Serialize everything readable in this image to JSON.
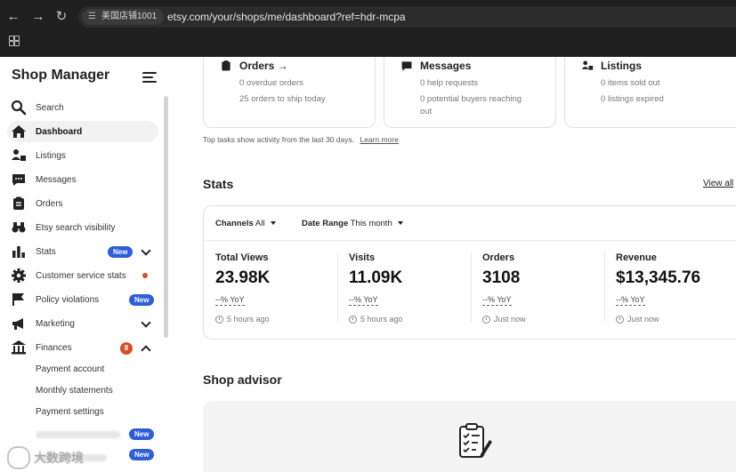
{
  "browser": {
    "url": "etsy.com/your/shops/me/dashboard?ref=hdr-mcpa",
    "site_label": "美国店铺1001"
  },
  "sidebar": {
    "title": "Shop Manager",
    "items": [
      {
        "label": "Search",
        "icon": "search-icon"
      },
      {
        "label": "Dashboard",
        "icon": "home-icon"
      },
      {
        "label": "Listings",
        "icon": "listings-icon"
      },
      {
        "label": "Messages",
        "icon": "messages-icon"
      },
      {
        "label": "Orders",
        "icon": "orders-icon"
      },
      {
        "label": "Etsy search visibility",
        "icon": "binoculars-icon"
      },
      {
        "label": "Stats",
        "icon": "stats-icon",
        "badge": "New"
      },
      {
        "label": "Customer service stats",
        "icon": "gear-icon"
      },
      {
        "label": "Policy violations",
        "icon": "flag-icon",
        "badge": "New"
      },
      {
        "label": "Marketing",
        "icon": "megaphone-icon"
      },
      {
        "label": "Finances",
        "icon": "bank-icon",
        "count": "8"
      }
    ],
    "finance_sub": [
      "Payment account",
      "Monthly statements",
      "Payment settings"
    ],
    "extra_badge_1": "New",
    "extra_badge_2": "New"
  },
  "tasks": [
    {
      "title": "Orders →",
      "lines": [
        "0 overdue orders",
        "25 orders to ship today"
      ]
    },
    {
      "title": "Messages",
      "lines": [
        "0 help requests",
        "0 potential buyers reaching",
        "out"
      ]
    },
    {
      "title": "Listings",
      "lines": [
        "0 items sold out",
        "0 listings expired"
      ]
    }
  ],
  "top_tasks_note": "Top tasks show activity from the last 30 days.",
  "learn_more": "Learn more",
  "stats": {
    "heading": "Stats",
    "view_all": "View all",
    "channels_label": "Channels",
    "channels_value": "All",
    "date_range_label": "Date Range",
    "date_range_value": "This month",
    "metrics": [
      {
        "label": "Total Views",
        "value": "23.98K",
        "yoy": "--% YoY",
        "time": "5 hours ago"
      },
      {
        "label": "Visits",
        "value": "11.09K",
        "yoy": "--% YoY",
        "time": "5 hours ago"
      },
      {
        "label": "Orders",
        "value": "3108",
        "yoy": "--% YoY",
        "time": "Just now"
      },
      {
        "label": "Revenue",
        "value": "$13,345.76",
        "yoy": "--% YoY",
        "time": "Just now"
      }
    ]
  },
  "advisor": {
    "heading": "Shop advisor"
  },
  "watermark": "大数跨境",
  "colors": {
    "chrome": "#1f1f1f",
    "badge_blue": "#2e5ed8",
    "alert_orange": "#d4502a"
  }
}
